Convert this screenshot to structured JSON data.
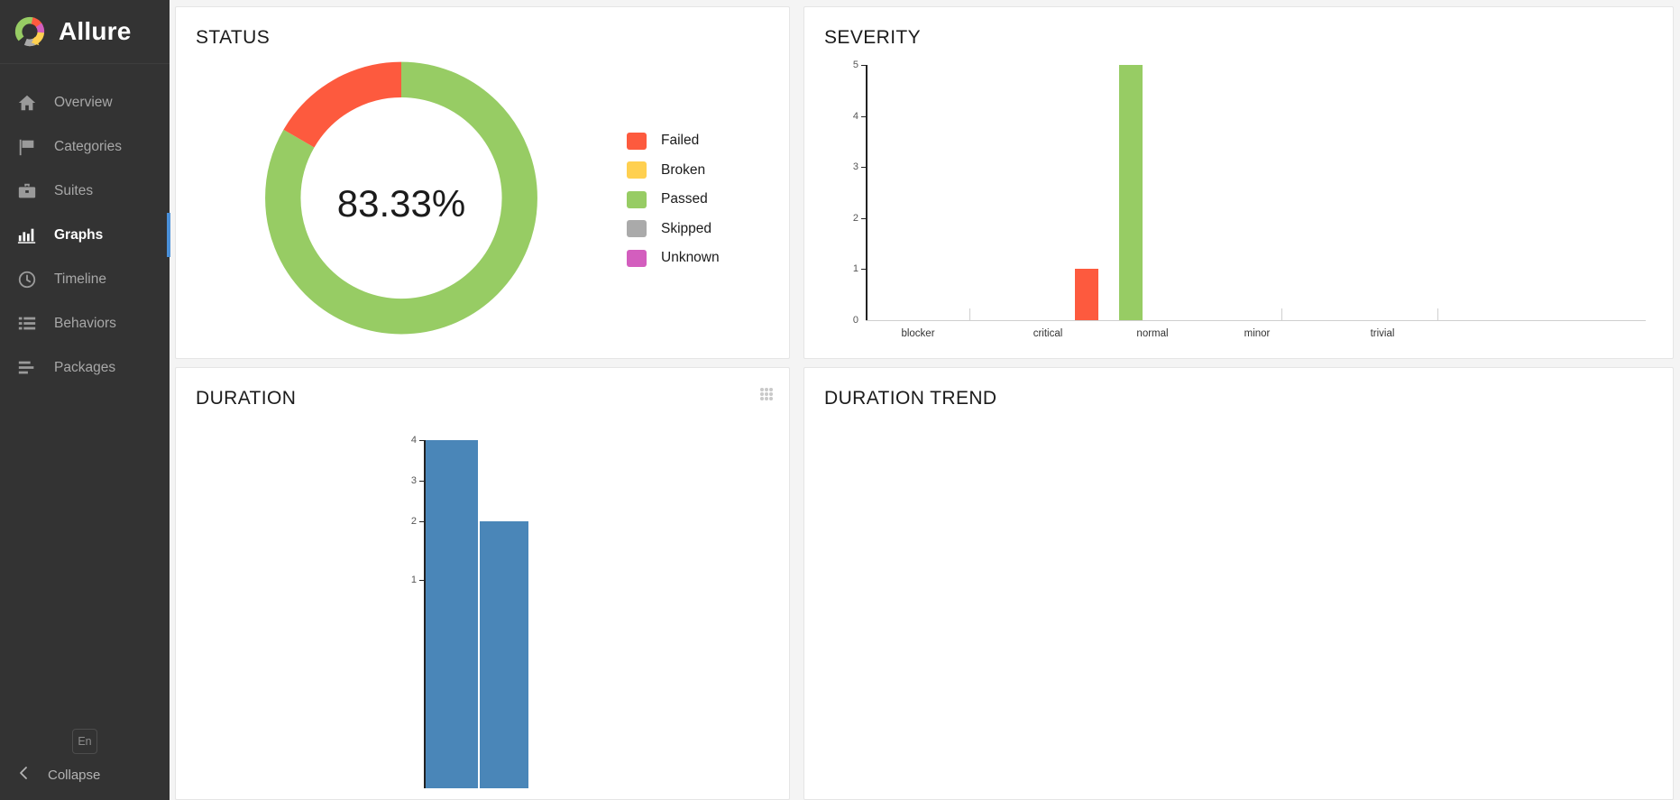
{
  "sidebar": {
    "brand": "Allure",
    "logo_icon": "allure-donut-logo",
    "items": [
      {
        "label": "Overview",
        "icon": "home-icon",
        "active": false
      },
      {
        "label": "Categories",
        "icon": "flag-icon",
        "active": false
      },
      {
        "label": "Suites",
        "icon": "briefcase-icon",
        "active": false
      },
      {
        "label": "Graphs",
        "icon": "bar-chart-icon",
        "active": true
      },
      {
        "label": "Timeline",
        "icon": "clock-icon",
        "active": false
      },
      {
        "label": "Behaviors",
        "icon": "list-icon",
        "active": false
      },
      {
        "label": "Packages",
        "icon": "packages-icon",
        "active": false
      }
    ],
    "language_button": "En",
    "collapse_label": "Collapse",
    "collapse_icon": "chevron-left-icon"
  },
  "cards": {
    "status_title": "STATUS",
    "severity_title": "SEVERITY",
    "duration_title": "DURATION",
    "duration_trend_title": "DURATION TREND",
    "duration_grip_icon": "drag-handle-icon"
  },
  "colors": {
    "failed": "#fd5a3e",
    "broken": "#ffd050",
    "passed": "#97cc64",
    "skipped": "#aaaaaa",
    "unknown": "#d35ebe",
    "duration_bar": "#4a86b8",
    "accent": "#4a90d9",
    "sidebar_bg": "#333333"
  },
  "chart_data": [
    {
      "type": "pie",
      "name": "status-donut",
      "title": "STATUS",
      "center_label": "83.33%",
      "legend_position": "right",
      "labels": [
        "Failed",
        "Broken",
        "Passed",
        "Skipped",
        "Unknown"
      ],
      "colors": [
        "#fd5a3e",
        "#ffd050",
        "#97cc64",
        "#aaaaaa",
        "#d35ebe"
      ],
      "values": [
        1,
        0,
        5,
        0,
        0
      ],
      "percentages": [
        16.67,
        0,
        83.33,
        0,
        0
      ]
    },
    {
      "type": "bar",
      "name": "severity-bars",
      "title": "SEVERITY",
      "categories": [
        "blocker",
        "critical",
        "normal",
        "minor",
        "trivial"
      ],
      "series": [
        {
          "name": "Failed",
          "color": "#fd5a3e",
          "values": [
            0,
            0,
            1,
            0,
            0
          ]
        },
        {
          "name": "Passed",
          "color": "#97cc64",
          "values": [
            0,
            0,
            5,
            0,
            0
          ]
        }
      ],
      "ylabel": "",
      "xlabel": "",
      "yticks": [
        0,
        1,
        2,
        3,
        4,
        5
      ],
      "ylim": [
        0,
        5
      ],
      "grid": false
    },
    {
      "type": "bar",
      "name": "duration-bars",
      "title": "DURATION",
      "categories": [
        "",
        ""
      ],
      "values": [
        4,
        2
      ],
      "color": "#4a86b8",
      "yticks": [
        1,
        2,
        3,
        4
      ],
      "ylim": [
        0,
        4
      ],
      "xlabel": "",
      "ylabel": "",
      "grid": false
    },
    {
      "type": "line",
      "name": "duration-trend",
      "title": "DURATION TREND",
      "x": [],
      "series": [],
      "note": ""
    }
  ]
}
